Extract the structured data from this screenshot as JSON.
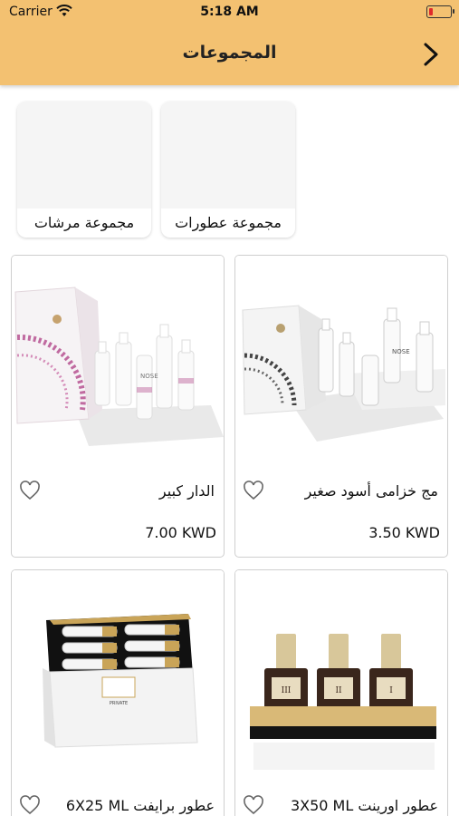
{
  "status_bar": {
    "carrier": "Carrier",
    "time": "5:18 AM"
  },
  "nav": {
    "title": "المجموعات",
    "back_icon": "chevron-right-icon"
  },
  "categories": [
    {
      "label": "مجموعة عطورات"
    },
    {
      "label": "مجموعة مرشات"
    }
  ],
  "products": [
    {
      "name": "مج خزامى أسود صغير",
      "price": "3.50 KWD"
    },
    {
      "name": "الدار كبير",
      "price": "7.00 KWD"
    },
    {
      "name": "عطور اورينت 3X50 ML",
      "price": ""
    },
    {
      "name": "عطور برايفت 6X25 ML",
      "price": ""
    }
  ],
  "product_images": {
    "1": {
      "box_text": "NOSE"
    },
    "2": {
      "box_text": "NOSE"
    },
    "3": {
      "bottle_labels": [
        "III",
        "II",
        "I"
      ]
    },
    "4": {
      "box_label": "PRIVATE"
    }
  },
  "colors": {
    "header": "#f3c171",
    "accent_pink": "#c06aa0",
    "card_border": "#cfcfcf"
  }
}
